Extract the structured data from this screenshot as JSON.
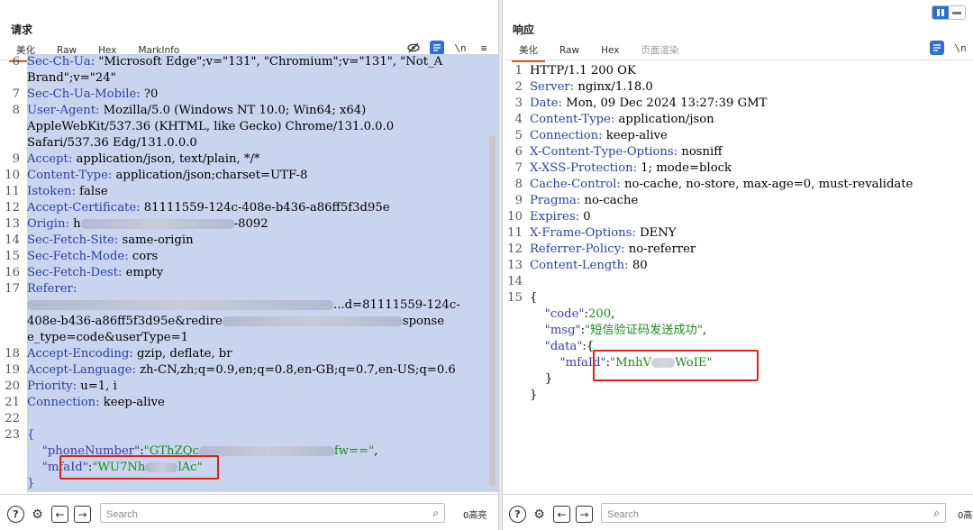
{
  "request": {
    "title": "请求",
    "tabs": [
      {
        "label": "美化",
        "active": true
      },
      {
        "label": "Raw",
        "active": false
      },
      {
        "label": "Hex",
        "active": false
      },
      {
        "label": "MarkInfo",
        "active": false
      }
    ],
    "tools": [
      "eye-off-icon",
      "wrap-icon",
      "newline-icon",
      "menu-icon"
    ],
    "newline_label": "\\n",
    "menu_label": "≡",
    "lines": [
      {
        "n": "6",
        "parts": [
          [
            "k",
            "Sec-Ch-Ua: "
          ],
          [
            "",
            "\"Microsoft Edge\";v=\"131\", \"Chromium\";v=\"131\", \"Not_A"
          ]
        ]
      },
      {
        "n": "",
        "parts": [
          [
            "",
            "Brand\";v=\"24\""
          ]
        ]
      },
      {
        "n": "7",
        "parts": [
          [
            "k",
            "Sec-Ch-Ua-Mobile: "
          ],
          [
            "",
            "?0"
          ]
        ]
      },
      {
        "n": "8",
        "parts": [
          [
            "k",
            "User-Agent: "
          ],
          [
            "",
            "Mozilla/5.0 (Windows NT 10.0; Win64; x64)"
          ]
        ]
      },
      {
        "n": "",
        "parts": [
          [
            "",
            "AppleWebKit/537.36 (KHTML, like Gecko) Chrome/131.0.0.0"
          ]
        ]
      },
      {
        "n": "",
        "parts": [
          [
            "",
            "Safari/537.36 Edg/131.0.0.0"
          ]
        ]
      },
      {
        "n": "9",
        "parts": [
          [
            "k",
            "Accept: "
          ],
          [
            "",
            "application/json, text/plain, */*"
          ]
        ]
      },
      {
        "n": "10",
        "parts": [
          [
            "k",
            "Content-Type: "
          ],
          [
            "",
            "application/json;charset=UTF-8"
          ]
        ]
      },
      {
        "n": "11",
        "parts": [
          [
            "k",
            "Istoken: "
          ],
          [
            "",
            "false"
          ]
        ]
      },
      {
        "n": "12",
        "parts": [
          [
            "k",
            "Accept-Certificate: "
          ],
          [
            "",
            "81111559-124c-408e-b436-a86ff5f3d95e"
          ]
        ]
      },
      {
        "n": "13",
        "parts": [
          [
            "k",
            "Origin: "
          ],
          [
            "",
            "h"
          ],
          [
            "blur",
            "170"
          ],
          [
            "",
            "-8092"
          ]
        ]
      },
      {
        "n": "14",
        "parts": [
          [
            "k",
            "Sec-Fetch-Site: "
          ],
          [
            "",
            "same-origin"
          ]
        ]
      },
      {
        "n": "15",
        "parts": [
          [
            "k",
            "Sec-Fetch-Mode: "
          ],
          [
            "",
            "cors"
          ]
        ]
      },
      {
        "n": "16",
        "parts": [
          [
            "k",
            "Sec-Fetch-Dest: "
          ],
          [
            "",
            "empty"
          ]
        ]
      },
      {
        "n": "17",
        "parts": [
          [
            "k",
            "Referer: "
          ]
        ]
      },
      {
        "n": "",
        "parts": [
          [
            "blur",
            "340"
          ],
          [
            "",
            "...d=81111559-124c-"
          ]
        ]
      },
      {
        "n": "",
        "parts": [
          [
            "",
            "408e-b436-a86ff5f3d95e&redire"
          ],
          [
            "blur",
            "200"
          ],
          [
            "",
            "sponse"
          ]
        ]
      },
      {
        "n": "",
        "parts": [
          [
            "",
            "e_type=code&userType=1"
          ]
        ]
      },
      {
        "n": "18",
        "parts": [
          [
            "k",
            "Accept-Encoding: "
          ],
          [
            "",
            "gzip, deflate, br"
          ]
        ]
      },
      {
        "n": "19",
        "parts": [
          [
            "k",
            "Accept-Language: "
          ],
          [
            "",
            "zh-CN,zh;q=0.9,en;q=0.8,en-GB;q=0.7,en-US;q=0.6"
          ]
        ]
      },
      {
        "n": "20",
        "parts": [
          [
            "k",
            "Priority: "
          ],
          [
            "",
            "u=1, i"
          ]
        ]
      },
      {
        "n": "21",
        "parts": [
          [
            "k",
            "Connection: "
          ],
          [
            "",
            "keep-alive"
          ]
        ]
      },
      {
        "n": "22",
        "parts": []
      },
      {
        "n": "23",
        "parts": [
          [
            "q",
            "{"
          ]
        ]
      },
      {
        "n": "",
        "parts": [
          [
            "",
            "    "
          ],
          [
            "q",
            "\"phoneNumber\""
          ],
          [
            "",
            ":"
          ],
          [
            "s",
            "\"GThZQc"
          ],
          [
            "blur",
            "150"
          ],
          [
            "s",
            "fw==\""
          ],
          [
            "",
            ","
          ]
        ]
      },
      {
        "n": "",
        "parts": [
          [
            "",
            "    "
          ],
          [
            "q",
            "\"mfaId\""
          ],
          [
            "",
            ":"
          ],
          [
            "s",
            "\"WU7Nh"
          ],
          [
            "blur",
            "36"
          ],
          [
            "s",
            "lAc\""
          ]
        ]
      },
      {
        "n": "",
        "parts": [
          [
            "q",
            "}"
          ]
        ]
      }
    ],
    "placeholder": "Search",
    "hits": "0高亮"
  },
  "response": {
    "title": "响应",
    "tabs": [
      {
        "label": "美化",
        "active": true
      },
      {
        "label": "Raw",
        "active": false
      },
      {
        "label": "Hex",
        "active": false
      },
      {
        "label": "页面渲染",
        "active": false
      }
    ],
    "newline_label": "\\n",
    "lines": [
      {
        "n": "1",
        "parts": [
          [
            "",
            "HTTP/1.1 200 OK"
          ]
        ]
      },
      {
        "n": "2",
        "parts": [
          [
            "k",
            "Server: "
          ],
          [
            "",
            "nginx/1.18.0"
          ]
        ]
      },
      {
        "n": "3",
        "parts": [
          [
            "k",
            "Date: "
          ],
          [
            "",
            "Mon, 09 Dec 2024 13:27:39 GMT"
          ]
        ]
      },
      {
        "n": "4",
        "parts": [
          [
            "k",
            "Content-Type: "
          ],
          [
            "",
            "application/json"
          ]
        ]
      },
      {
        "n": "5",
        "parts": [
          [
            "k",
            "Connection: "
          ],
          [
            "",
            "keep-alive"
          ]
        ]
      },
      {
        "n": "6",
        "parts": [
          [
            "k",
            "X-Content-Type-Options: "
          ],
          [
            "",
            "nosniff"
          ]
        ]
      },
      {
        "n": "7",
        "parts": [
          [
            "k",
            "X-XSS-Protection: "
          ],
          [
            "",
            "1; mode=block"
          ]
        ]
      },
      {
        "n": "8",
        "parts": [
          [
            "k",
            "Cache-Control: "
          ],
          [
            "",
            "no-cache, no-store, max-age=0, must-revalidate"
          ]
        ]
      },
      {
        "n": "9",
        "parts": [
          [
            "k",
            "Pragma: "
          ],
          [
            "",
            "no-cache"
          ]
        ]
      },
      {
        "n": "10",
        "parts": [
          [
            "k",
            "Expires: "
          ],
          [
            "",
            "0"
          ]
        ]
      },
      {
        "n": "11",
        "parts": [
          [
            "k",
            "X-Frame-Options: "
          ],
          [
            "",
            "DENY"
          ]
        ]
      },
      {
        "n": "12",
        "parts": [
          [
            "k",
            "Referrer-Policy: "
          ],
          [
            "",
            "no-referrer"
          ]
        ]
      },
      {
        "n": "13",
        "parts": [
          [
            "k",
            "Content-Length: "
          ],
          [
            "",
            "80"
          ]
        ]
      },
      {
        "n": "14",
        "parts": []
      },
      {
        "n": "15",
        "parts": [
          [
            "",
            "{"
          ]
        ]
      },
      {
        "n": "",
        "parts": [
          [
            "",
            "    "
          ],
          [
            "q",
            "\"code\""
          ],
          [
            "",
            ":"
          ],
          [
            "n",
            "200"
          ],
          [
            "",
            ","
          ]
        ]
      },
      {
        "n": "",
        "parts": [
          [
            "",
            "    "
          ],
          [
            "q",
            "\"msg\""
          ],
          [
            "",
            ":"
          ],
          [
            "s",
            "\"短信验证码发送成功\""
          ],
          [
            "",
            ","
          ]
        ]
      },
      {
        "n": "",
        "parts": [
          [
            "",
            "    "
          ],
          [
            "q",
            "\"data\""
          ],
          [
            "",
            ":{"
          ]
        ]
      },
      {
        "n": "",
        "parts": [
          [
            "",
            "        "
          ],
          [
            "q",
            "\"mfaId\""
          ],
          [
            "",
            ":"
          ],
          [
            "s",
            "\"MnhV"
          ],
          [
            "blur",
            "26"
          ],
          [
            "s",
            "WoIE\""
          ]
        ]
      },
      {
        "n": "",
        "parts": [
          [
            "",
            "    }"
          ]
        ]
      },
      {
        "n": "",
        "parts": [
          [
            "",
            "}"
          ]
        ]
      }
    ],
    "placeholder": "Search",
    "hits": "0高"
  },
  "colors": {
    "accent": "#e8590c",
    "highlight": "#c9d5ee",
    "header_key": "#2a3fa8",
    "string": "#1a8a1a",
    "annotation_red": "#e0201b"
  }
}
